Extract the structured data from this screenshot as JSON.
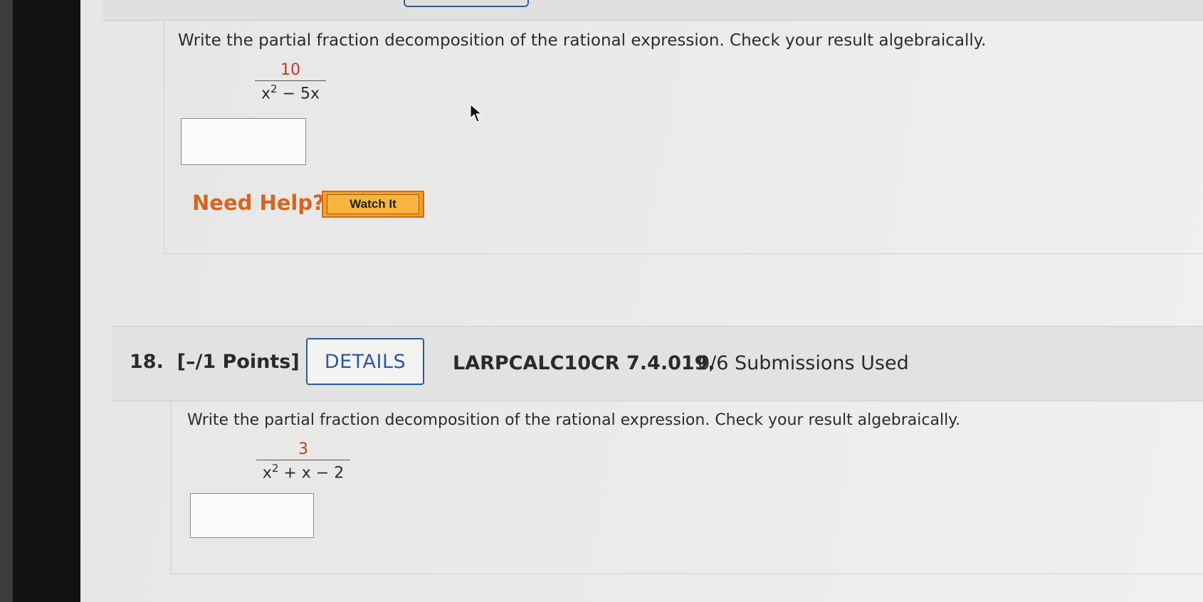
{
  "question_17": {
    "instruction": "Write the partial fraction decomposition of the rational expression. Check your result algebraically.",
    "numerator": "10",
    "denominator_base": "x",
    "denominator_exp": "2",
    "denominator_rest": " − 5x",
    "answer_value": "",
    "help_label": "Need Help?",
    "watch_label": "Watch It"
  },
  "question_18": {
    "number": "18.",
    "points": "[–/1 Points]",
    "details_label": "DETAILS",
    "code": "LARPCALC10CR 7.4.019.",
    "submissions": "0/6 Submissions Used",
    "instruction": "Write the partial fraction decomposition of the rational expression. Check your result algebraically.",
    "numerator": "3",
    "denominator_base": "x",
    "denominator_exp": "2",
    "denominator_rest": " + x − 2",
    "answer_value": ""
  }
}
